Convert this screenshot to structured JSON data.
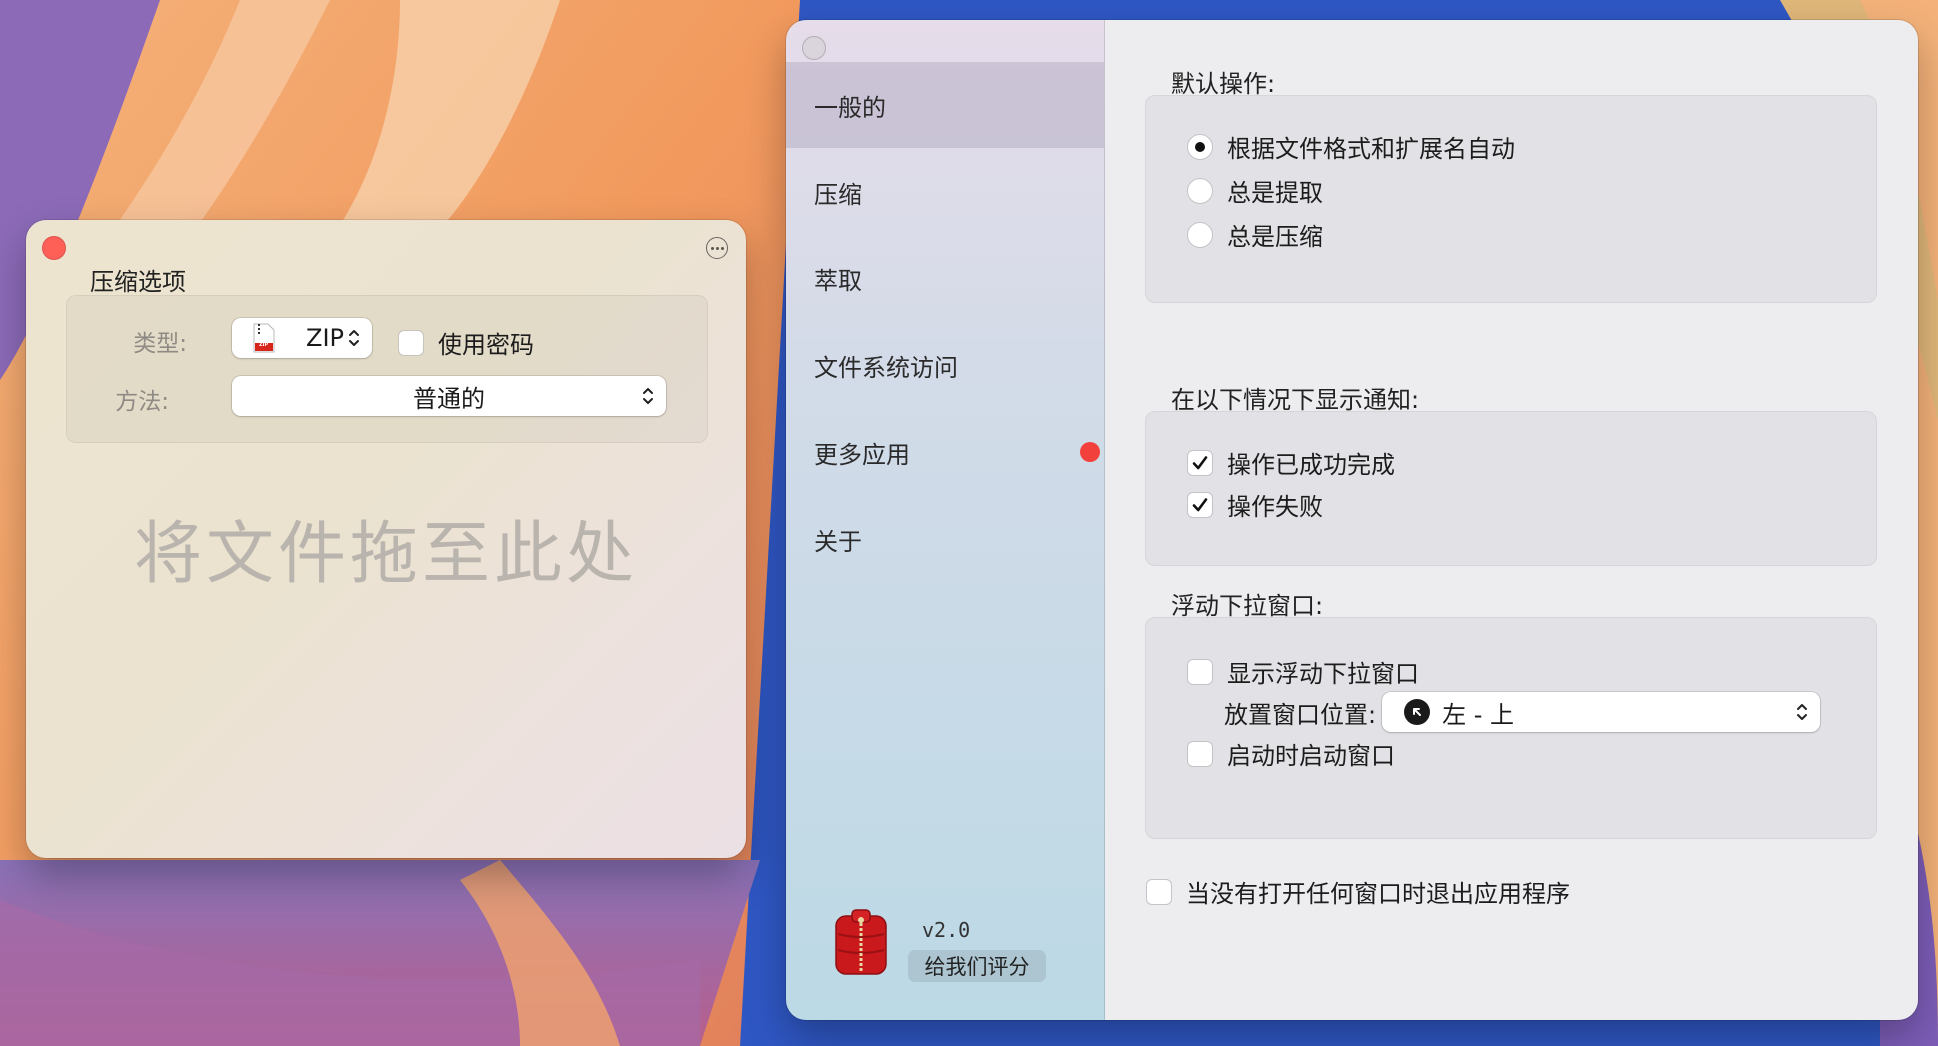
{
  "compress_window": {
    "title": "压缩选项",
    "type_label": "类型:",
    "type_value": "ZIP",
    "type_icon_label": "ZIP",
    "use_password_label": "使用密码",
    "use_password_checked": false,
    "method_label": "方法:",
    "method_value": "普通的",
    "drop_hint": "将文件拖至此处"
  },
  "settings_window": {
    "sidebar": {
      "items": [
        {
          "label": "一般的",
          "selected": true,
          "badge": false
        },
        {
          "label": "压缩",
          "selected": false,
          "badge": false
        },
        {
          "label": "萃取",
          "selected": false,
          "badge": false
        },
        {
          "label": "文件系统访问",
          "selected": false,
          "badge": false
        },
        {
          "label": "更多应用",
          "selected": false,
          "badge": true
        },
        {
          "label": "关于",
          "selected": false,
          "badge": false
        }
      ],
      "version": "v2.0",
      "rate_button": "给我们评分"
    },
    "default_action": {
      "title": "默认操作:",
      "options": [
        {
          "label": "根据文件格式和扩展名自动",
          "selected": true
        },
        {
          "label": "总是提取",
          "selected": false
        },
        {
          "label": "总是压缩",
          "selected": false
        }
      ]
    },
    "notifications": {
      "title": "在以下情况下显示通知:",
      "options": [
        {
          "label": "操作已成功完成",
          "checked": true
        },
        {
          "label": "操作失败",
          "checked": true
        }
      ]
    },
    "floating_window": {
      "title": "浮动下拉窗口:",
      "show_label": "显示浮动下拉窗口",
      "show_checked": false,
      "position_label": "放置窗口位置:",
      "position_value": "左 - 上",
      "launch_label": "启动时启动窗口",
      "launch_checked": false
    },
    "quit_option": {
      "label": "当没有打开任何窗口时退出应用程序",
      "checked": false
    }
  },
  "colors": {
    "close_red": "#fe5f57",
    "badge_red": "#f2403c",
    "zip_red": "#d9261c"
  }
}
